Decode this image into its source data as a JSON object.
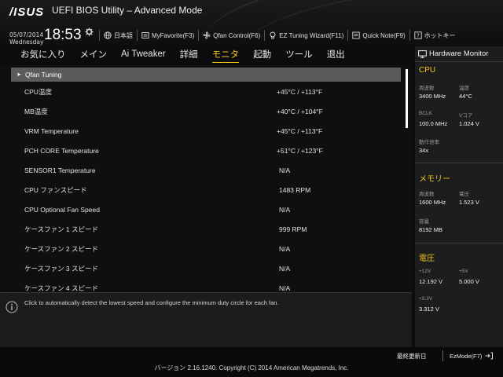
{
  "header": {
    "logo": "/ISUS",
    "title": "UEFI BIOS Utility – Advanced Mode",
    "date": "05/07/2014",
    "weekday": "Wednesday",
    "time": "18:53"
  },
  "toolbar": [
    {
      "label": "日本語",
      "icon": "globe-icon"
    },
    {
      "label": "MyFavorite(F3)",
      "icon": "favorite-icon"
    },
    {
      "label": "Qfan Control(F6)",
      "icon": "fan-icon"
    },
    {
      "label": "EZ Tuning Wizard(F11)",
      "icon": "lightbulb-icon"
    },
    {
      "label": "Quick Note(F9)",
      "icon": "note-icon"
    },
    {
      "label": "ホットキー",
      "icon": "help-icon"
    }
  ],
  "menu": {
    "tabs": [
      "お気に入り",
      "メイン",
      "Ai Tweaker",
      "詳細",
      "モニタ",
      "起動",
      "ツール",
      "退出"
    ],
    "active": "モニタ"
  },
  "rows": [
    {
      "label": "Qfan Tuning",
      "value": ""
    },
    {
      "label": "CPU温度",
      "value": "+45°C / +113°F"
    },
    {
      "label": "MB温度",
      "value": "+40°C / +104°F"
    },
    {
      "label": "VRM Temperature",
      "value": "+45°C / +113°F"
    },
    {
      "label": "PCH CORE Temperature",
      "value": "+51°C / +123°F"
    },
    {
      "label": "SENSOR1 Temperature",
      "value": "N/A"
    },
    {
      "label": "CPU ファンスピード",
      "value": "1483 RPM"
    },
    {
      "label": "CPU Optional Fan Speed",
      "value": "N/A"
    },
    {
      "label": "ケースファン 1 スピード",
      "value": "999 RPM"
    },
    {
      "label": "ケースファン 2 スピード",
      "value": "N/A"
    },
    {
      "label": "ケースファン 3 スピード",
      "value": "N/A"
    },
    {
      "label": "ケースファン 4 スピード",
      "value": "N/A"
    }
  ],
  "help_text": "Click to automatically detect the lowest speed and configure the minimum duty circle for each fan.",
  "hardware_monitor": {
    "title": "Hardware Monitor",
    "cpu": {
      "heading": "CPU",
      "freq_label": "周波数",
      "freq": "3400 MHz",
      "temp_label": "温度",
      "temp": "44°C",
      "bclk_label": "BCLK",
      "bclk": "100.0 MHz",
      "vcore_label": "Vコア",
      "vcore": "1.024 V",
      "ratio_label": "動作倍率",
      "ratio": "34x"
    },
    "memory": {
      "heading": "メモリー",
      "freq_label": "周波数",
      "freq": "1600 MHz",
      "volt_label": "電圧",
      "volt": "1.523 V",
      "cap_label": "容量",
      "cap": "8192 MB"
    },
    "voltage": {
      "heading": "電圧",
      "v12_label": "+12V",
      "v12": "12.192 V",
      "v5_label": "+5V",
      "v5": "5.000 V",
      "v33_label": "+3.3V",
      "v33": "3.312 V"
    }
  },
  "footer": {
    "last_modified": "最終更新日",
    "ezmode": "EzMode(F7)",
    "copyright": "バージョン 2.16.1240. Copyright (C) 2014 American Megatrends, Inc."
  },
  "colors": {
    "accent": "#f5c518",
    "selected_row": "#5a5b5d",
    "panel": "#1c1d1f"
  }
}
